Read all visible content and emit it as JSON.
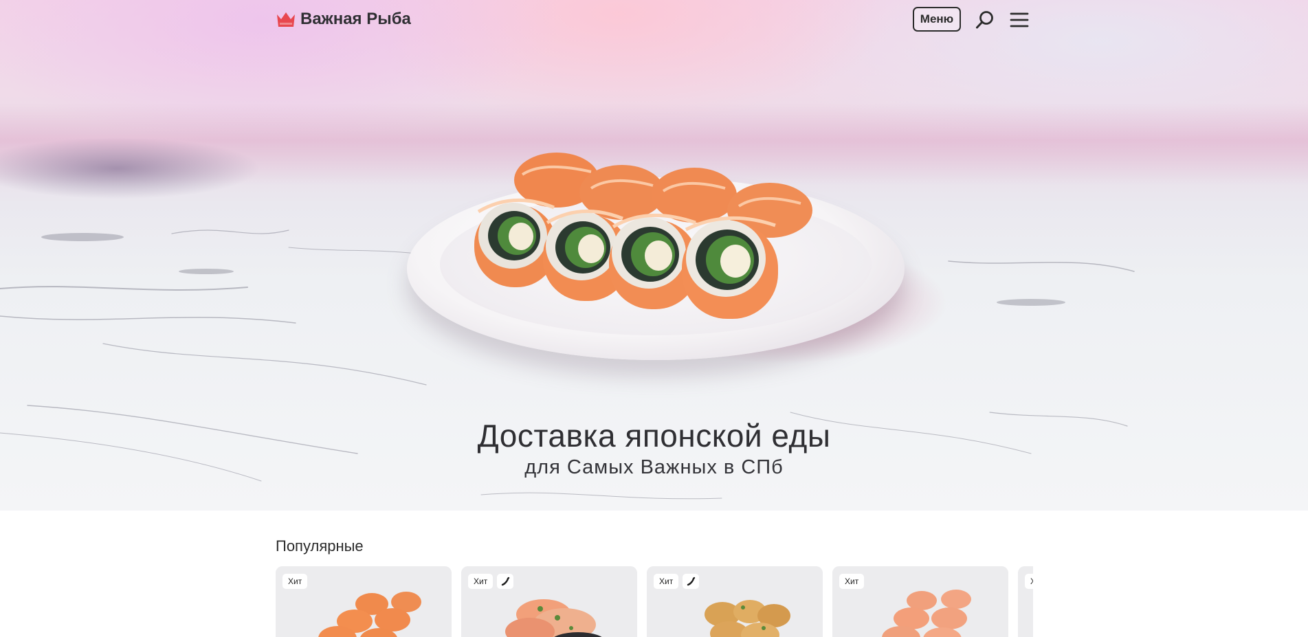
{
  "header": {
    "logo_text": "Важная Рыба",
    "menu_label": "Меню",
    "accent_color": "#e8474f"
  },
  "hero": {
    "title": "Доставка японской еды",
    "subtitle": "для Самых Важных в СПб"
  },
  "popular": {
    "title": "Популярные",
    "cards": [
      {
        "badges": [
          "Хит"
        ],
        "spicy": false
      },
      {
        "badges": [
          "Хит"
        ],
        "spicy": true
      },
      {
        "badges": [
          "Хит"
        ],
        "spicy": true
      },
      {
        "badges": [
          "Хит"
        ],
        "spicy": false
      },
      {
        "badges": [
          "Хит"
        ],
        "spicy": false
      }
    ]
  }
}
